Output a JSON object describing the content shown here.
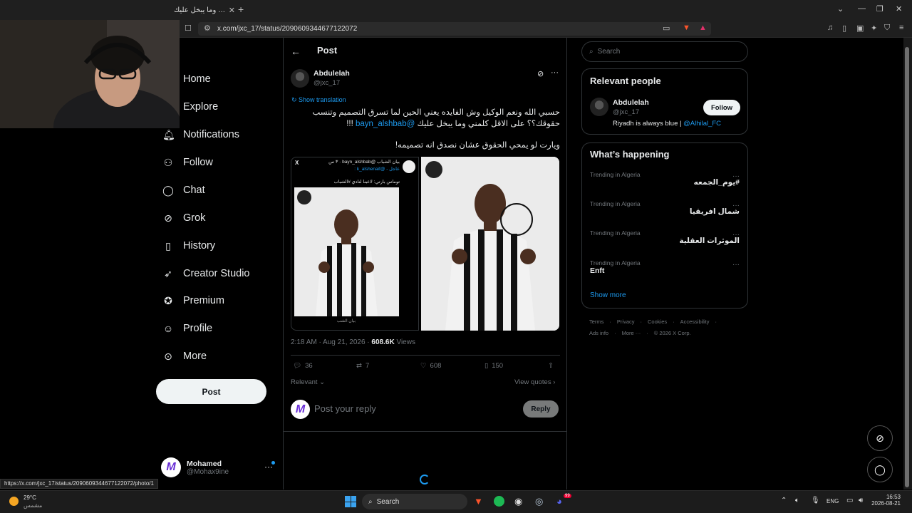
{
  "browser": {
    "tab_title": "وما يبخل عليك …",
    "url": "x.com/jxc_17/status/2090609344677122072",
    "status_url": "https://x.com/jxc_17/status/2090609344677122072/photo/1"
  },
  "nav": {
    "items": [
      "Home",
      "Explore",
      "Notifications",
      "Follow",
      "Chat",
      "Grok",
      "History",
      "Creator Studio",
      "Premium",
      "Profile",
      "More"
    ],
    "post_label": "Post",
    "me_name": "Mohamed",
    "me_handle": "@Mohax9ine",
    "me_avatar_letter": "M"
  },
  "header": {
    "title": "Post"
  },
  "tweet": {
    "author": "Abdulelah",
    "handle": "@jxc_17",
    "show_translation": "Show translation",
    "text_line1": "حسبي الله ونعم الوكيل وش الفايده يعني الحين لما تسرق التصميم وتنسب",
    "text_line2_pre": "حقوقك؟؟ على الاقل كلمني وما يبخل عليك",
    "mention": "@bayn_alshbab",
    "text_line2_post": "!!!",
    "text_line3": "ويارت لو يمحي الحقوق عشان نصدق انه تصميمه!",
    "time": "2:18 AM · Aug 21, 2026 · ",
    "views_count": "608.6K",
    "views_label": " Views",
    "replies": "36",
    "reposts": "7",
    "likes": "608",
    "bookmarks": "150",
    "sort_label": "Relevant",
    "quotes_label": "View quotes",
    "img1_header": "بيان الشباب @bayn_alshbab · ٣ س",
    "img1_sub": "عاجل - @k_alshenaif :",
    "img1_caption": "توماس بارتي: لاعبنا لنادي #الشباب",
    "img1_footer": "بيان الشب",
    "img1_x": "X"
  },
  "reply": {
    "placeholder": "Post your reply",
    "button": "Reply"
  },
  "right": {
    "search_placeholder": "Search",
    "relevant_title": "Relevant people",
    "person_name": "Abdulelah",
    "person_handle": "@jxc_17",
    "follow_label": "Follow",
    "bio_pre": "Riyadh is always blue | ",
    "bio_link": "@Alhilal_FC",
    "happening_title": "What’s happening",
    "trends": [
      {
        "category": "Trending in Algeria",
        "title": "#يوم_الجمعه"
      },
      {
        "category": "Trending in Algeria",
        "title": "شمال افريقيا"
      },
      {
        "category": "Trending in Algeria",
        "title": "الموثرات العقلية"
      },
      {
        "category": "Trending in Algeria",
        "title": "Enft"
      }
    ],
    "show_more": "Show more",
    "footer1": [
      "Terms",
      "Privacy",
      "Cookies",
      "Accessibility"
    ],
    "footer2": [
      "Ads info",
      "More ···",
      "© 2026 X Corp."
    ]
  },
  "taskbar": {
    "temp": "29°C",
    "weather": "مشمس",
    "search": "Search",
    "lang": "ENG",
    "time": "16:53",
    "date": "2026-08-21",
    "badge": "99"
  },
  "colors": {
    "accent": "#1d9bf0",
    "bg": "#000000",
    "border": "#2f3336"
  }
}
